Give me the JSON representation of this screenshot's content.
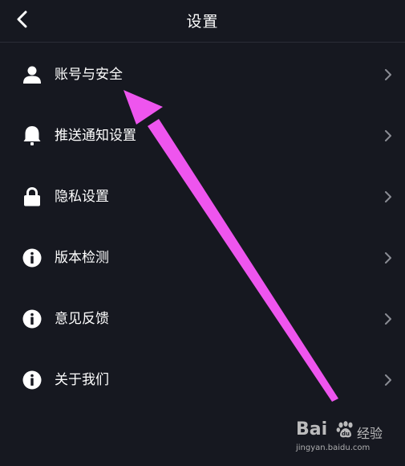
{
  "header": {
    "title": "设置"
  },
  "menu": {
    "items": [
      {
        "label": "账号与安全",
        "icon": "user-icon"
      },
      {
        "label": "推送通知设置",
        "icon": "bell-icon"
      },
      {
        "label": "隐私设置",
        "icon": "lock-icon"
      },
      {
        "label": "版本检测",
        "icon": "info-icon"
      },
      {
        "label": "意见反馈",
        "icon": "info-icon"
      },
      {
        "label": "关于我们",
        "icon": "info-icon"
      }
    ]
  },
  "colors": {
    "background": "#161820",
    "text": "#ffffff",
    "divider": "#2b2d36",
    "chevron": "#8a8c94",
    "annotation_arrow": "#ee55ee"
  },
  "watermark": {
    "logo": "Bai",
    "logo_suffix": "经验",
    "url": "jingyan.baidu.com"
  }
}
